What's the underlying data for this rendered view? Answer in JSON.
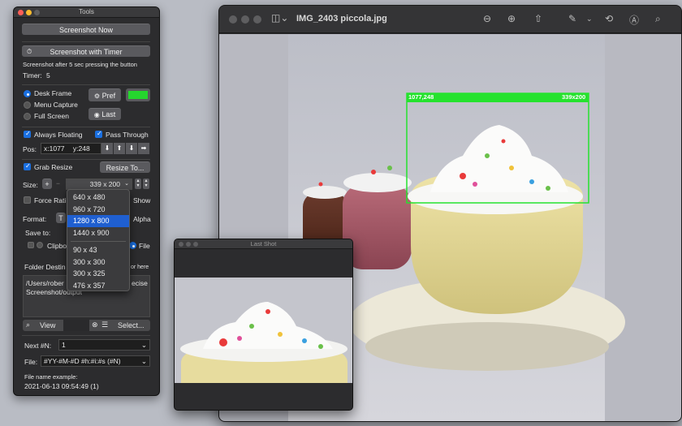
{
  "tools": {
    "title": "Tools",
    "screenshot_now": "Screenshot Now",
    "screenshot_timer": "Screenshot with Timer",
    "timer_hint": "Screenshot after 5 sec pressing the button",
    "timer_label": "Timer:",
    "timer_value": "5",
    "modes": [
      "Desk Frame",
      "Menu Capture",
      "Full Screen"
    ],
    "pref_label": "Pref",
    "last_label": "Last",
    "frame_color": "#25d62e",
    "always_floating": "Always Floating",
    "pass_through": "Pass Through",
    "pos_label": "Pos:",
    "pos_x": "x:1077",
    "pos_y": "y:248",
    "grab_resize": "Grab Resize",
    "resize_to": "Resize To...",
    "size_label": "Size:",
    "size_value": "339 x 200",
    "force_ratio": "Force Rati",
    "show_label": "Show",
    "format_label": "Format:",
    "format_partial": "T",
    "alpha_label": "Alpha",
    "save_to": "Save to:",
    "clipboard_partial": "Clipbo",
    "file_label": "File",
    "folder_dest": "Folder Destin",
    "folder_hint": "or here",
    "folder_path_line1": "/Users/rober",
    "folder_path_line1_end": "ecise",
    "folder_path_line2": "Screenshot/output",
    "view_label": "View",
    "select_label": "Select...",
    "next_label": "Next #N:",
    "next_value": "1",
    "file_pattern_label": "File:",
    "file_pattern": "#YY-#M-#D #h:#i:#s (#N)",
    "example_label": "File name example:",
    "example_value": "2021-06-13 09:54:49 (1)"
  },
  "dropdown": {
    "items_top": [
      "640 x 480",
      "960 x 720",
      "1280 x 800",
      "1440 x 900"
    ],
    "items_bottom": [
      "90 x 43",
      "300 x 300",
      "300 x 325",
      "476 x 357"
    ],
    "selected": "1280 x 800"
  },
  "preview": {
    "filename": "IMG_2403 piccola.jpg",
    "selection_pos": "1077,248",
    "selection_size": "339x200",
    "selection_color": "#25e22e"
  },
  "lastshot": {
    "title": "Last Shot"
  }
}
